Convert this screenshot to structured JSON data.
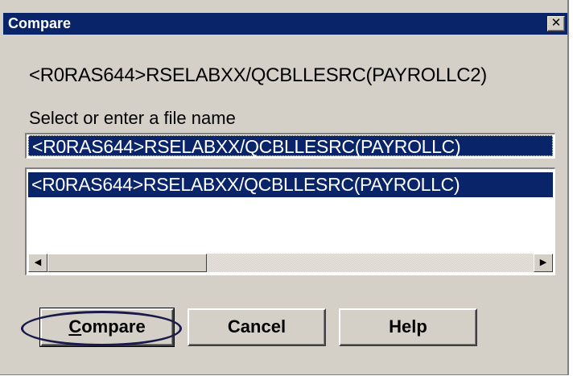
{
  "window": {
    "title": "Compare",
    "close_glyph": "✕"
  },
  "source_path": "<R0RAS644>RSELABXX/QCBLLESRC(PAYROLLC2)",
  "prompt_label": "Select or enter a file name",
  "file_input": {
    "value": "<R0RAS644>RSELABXX/QCBLLESRC(PAYROLLC)"
  },
  "file_list": {
    "items": [
      "<R0RAS644>RSELABXX/QCBLLESRC(PAYROLLC)"
    ],
    "selected_index": 0
  },
  "scrollbar": {
    "left_arrow": "◀",
    "right_arrow": "▶"
  },
  "buttons": {
    "compare_first": "C",
    "compare_rest": "ompare",
    "cancel": "Cancel",
    "help": "Help"
  },
  "colors": {
    "title_bar": "#0a246a",
    "selection": "#0a246a",
    "dialog_face": "#d4d0c8",
    "highlight_ellipse": "#1a1a4a"
  },
  "icons": [
    "close-icon",
    "scroll-left-icon",
    "scroll-right-icon"
  ]
}
